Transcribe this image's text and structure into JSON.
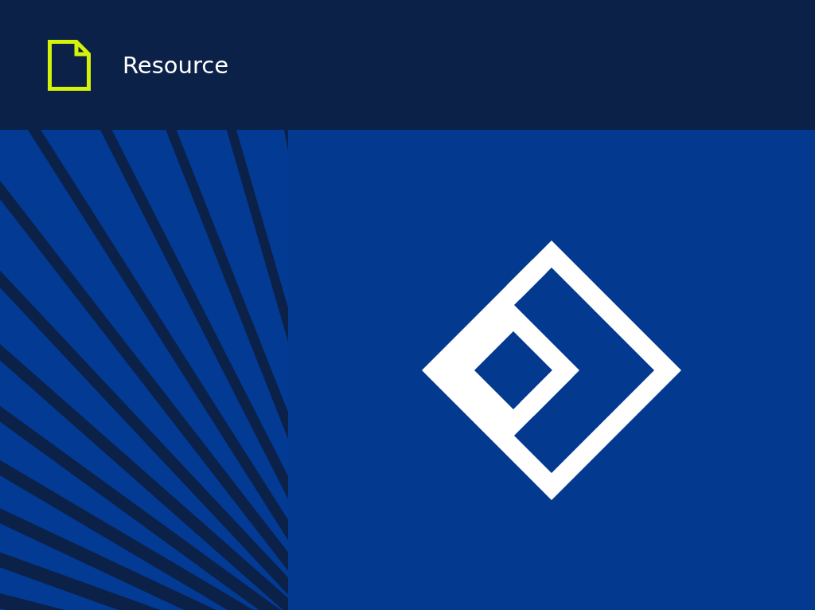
{
  "header": {
    "title": "Resource"
  }
}
